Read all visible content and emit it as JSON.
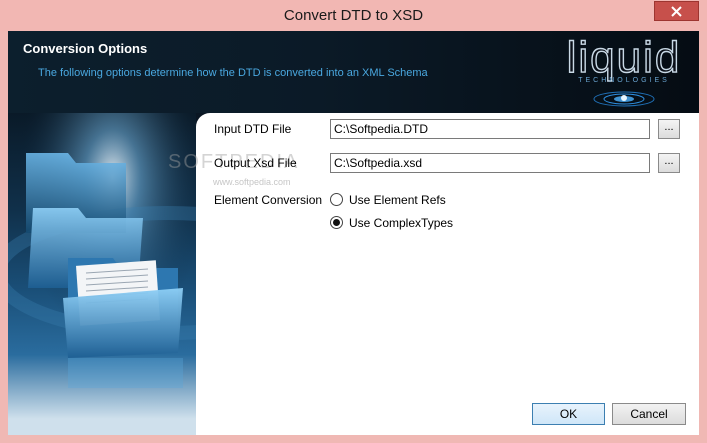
{
  "window": {
    "title": "Convert DTD to XSD",
    "close_glyph": "✕"
  },
  "header": {
    "title": "Conversion Options",
    "description": "The following options determine how the DTD is converted into an XML Schema"
  },
  "logo": {
    "word": "liquid",
    "sub": "TECHNOLOGIES"
  },
  "form": {
    "input_dtd": {
      "label": "Input DTD File",
      "value": "C:\\Softpedia.DTD",
      "browse_label": "..."
    },
    "output_xsd": {
      "label": "Output Xsd File",
      "value": "C:\\Softpedia.xsd",
      "browse_label": "..."
    },
    "element_conversion": {
      "label": "Element Conversion",
      "options": [
        {
          "label": "Use Element Refs",
          "checked": false
        },
        {
          "label": "Use ComplexTypes",
          "checked": true
        }
      ]
    }
  },
  "buttons": {
    "ok": "OK",
    "cancel": "Cancel"
  },
  "watermark": {
    "text": "SOFTPEDIA",
    "sub": "www.softpedia.com"
  },
  "colors": {
    "titlebar": "#f2b7b3",
    "close": "#c7504b",
    "banner": "#0b1a27",
    "accent_text": "#4aa8e0",
    "default_button_border": "#3c7fb1"
  }
}
